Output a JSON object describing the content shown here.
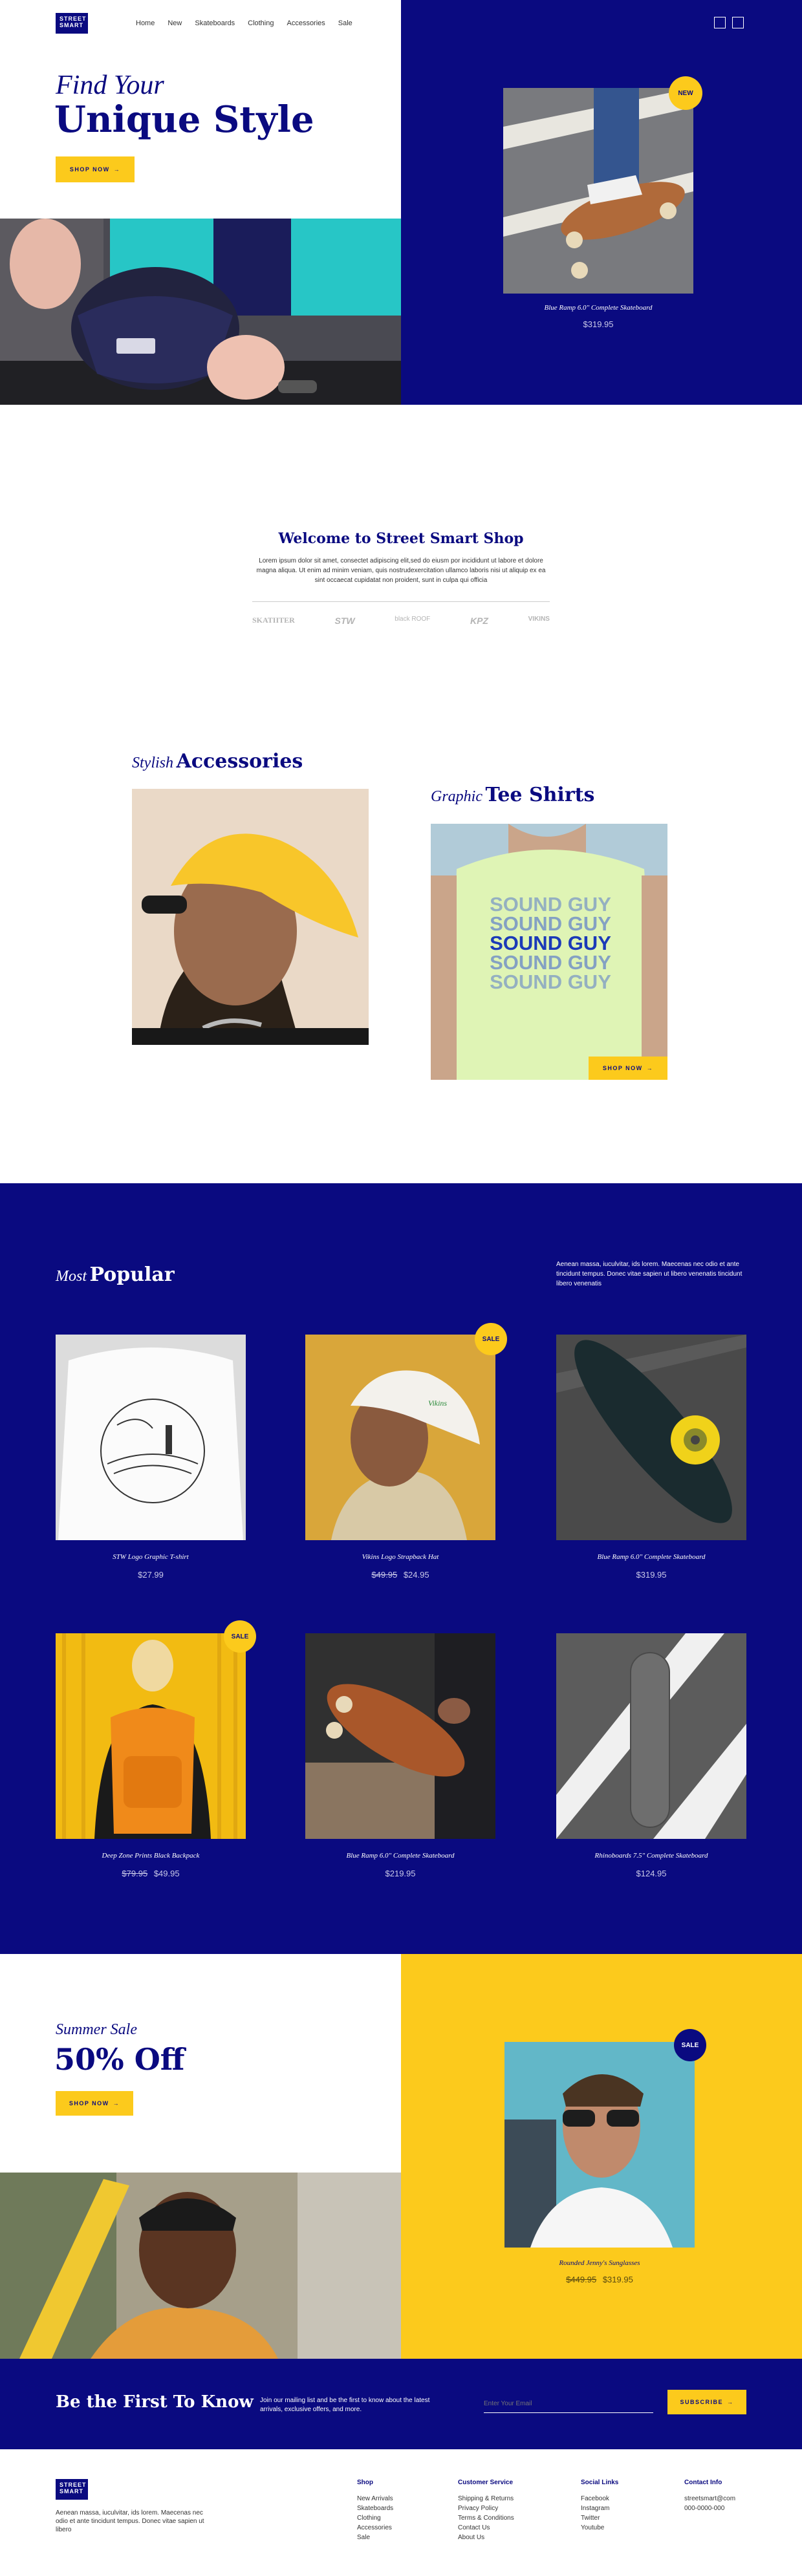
{
  "header": {
    "logo_line1": "STREET",
    "logo_line2": "SMART",
    "nav": [
      "Home",
      "New",
      "Skateboards",
      "Clothing",
      "Accessories",
      "Sale"
    ]
  },
  "hero": {
    "kicker": "Find Your",
    "title": "Unique Style",
    "cta": "SHOP NOW",
    "badge": "NEW",
    "product_name": "Blue Ramp 6.0\" Complete Skateboard",
    "product_price": "$319.95"
  },
  "welcome": {
    "title": "Welcome to Street Smart Shop",
    "body": "Lorem ipsum dolor sit amet, consectet adipiscing elit,sed do eiusm por incididunt ut labore et dolore magna aliqua. Ut enim ad minim veniam, quis nostrudexercitation ullamco laboris nisi ut aliquip ex ea sint occaecat cupidatat non proident, sunt in culpa qui officia",
    "brands": [
      "SKATIITER",
      "STW",
      "black ROOF",
      "KPZ",
      "VIKINS"
    ]
  },
  "categories": {
    "accessories_kicker": "Stylish",
    "accessories_title": "Accessories",
    "tees_kicker": "Graphic",
    "tees_title": "Tee Shirts",
    "tees_cta": "SHOP NOW",
    "tee_print": [
      "SOUND GUY",
      "SOUND GUY",
      "SOUND GUY",
      "SOUND GUY",
      "SOUND GUY"
    ]
  },
  "popular": {
    "kicker": "Most",
    "title": "Popular",
    "intro": "Aenean massa, iuculvitar, ids lorem. Maecenas nec odio et ante tincidunt tempus. Donec vitae sapien ut libero venenatis tincidunt libero venenatis",
    "sale_badge": "SALE",
    "products": [
      {
        "name": "STW Logo Graphic T-shirt",
        "price": "$27.99",
        "old": ""
      },
      {
        "name": "Vikins Logo Strapback Hat",
        "price": "$24.95",
        "old": "$49.95"
      },
      {
        "name": "Blue Ramp 6.0\" Complete Skateboard",
        "price": "$319.95",
        "old": ""
      },
      {
        "name": "Deep Zone Prints Black Backpack",
        "price": "$49.95",
        "old": "$79.95"
      },
      {
        "name": "Blue Ramp 6.0\" Complete Skateboard",
        "price": "$219.95",
        "old": ""
      },
      {
        "name": "Rhinoboards 7.5\" Complete Skateboard",
        "price": "$124.95",
        "old": ""
      }
    ]
  },
  "promo": {
    "kicker": "Summer Sale",
    "title": "50% Off",
    "cta": "SHOP NOW",
    "badge": "SALE",
    "product_name": "Rounded Jenny's Sunglasses",
    "old": "$449.95",
    "price": "$319.95"
  },
  "newsletter": {
    "title": "Be the First To Know",
    "body": "Join our mailing list and be the first to know about the latest arrivals, exclusive offers, and more.",
    "placeholder": "Enter Your Email",
    "cta": "SUBSCRIBE"
  },
  "footer": {
    "about": "Aenean massa, iuculvitar, ids lorem. Maecenas nec odio et ante tincidunt tempus. Donec vitae sapien ut libero",
    "shop_title": "Shop",
    "shop": [
      "New Arrivals",
      "Skateboards",
      "Clothing",
      "Accessories",
      "Sale"
    ],
    "service_title": "Customer Service",
    "service": [
      "Shipping & Returns",
      "Privacy Policy",
      "Terms & Conditions",
      "Contact Us",
      "About Us"
    ],
    "social_title": "Social Links",
    "social": [
      "Facebook",
      "Instagram",
      "Twitter",
      "Youtube"
    ],
    "contact_title": "Contact Info",
    "contact": [
      "streetsmart@com",
      "000-0000-000"
    ]
  },
  "colors": {
    "navy": "#0a0a80",
    "yellow": "#fcca1c",
    "teal": "#27c6c6"
  }
}
